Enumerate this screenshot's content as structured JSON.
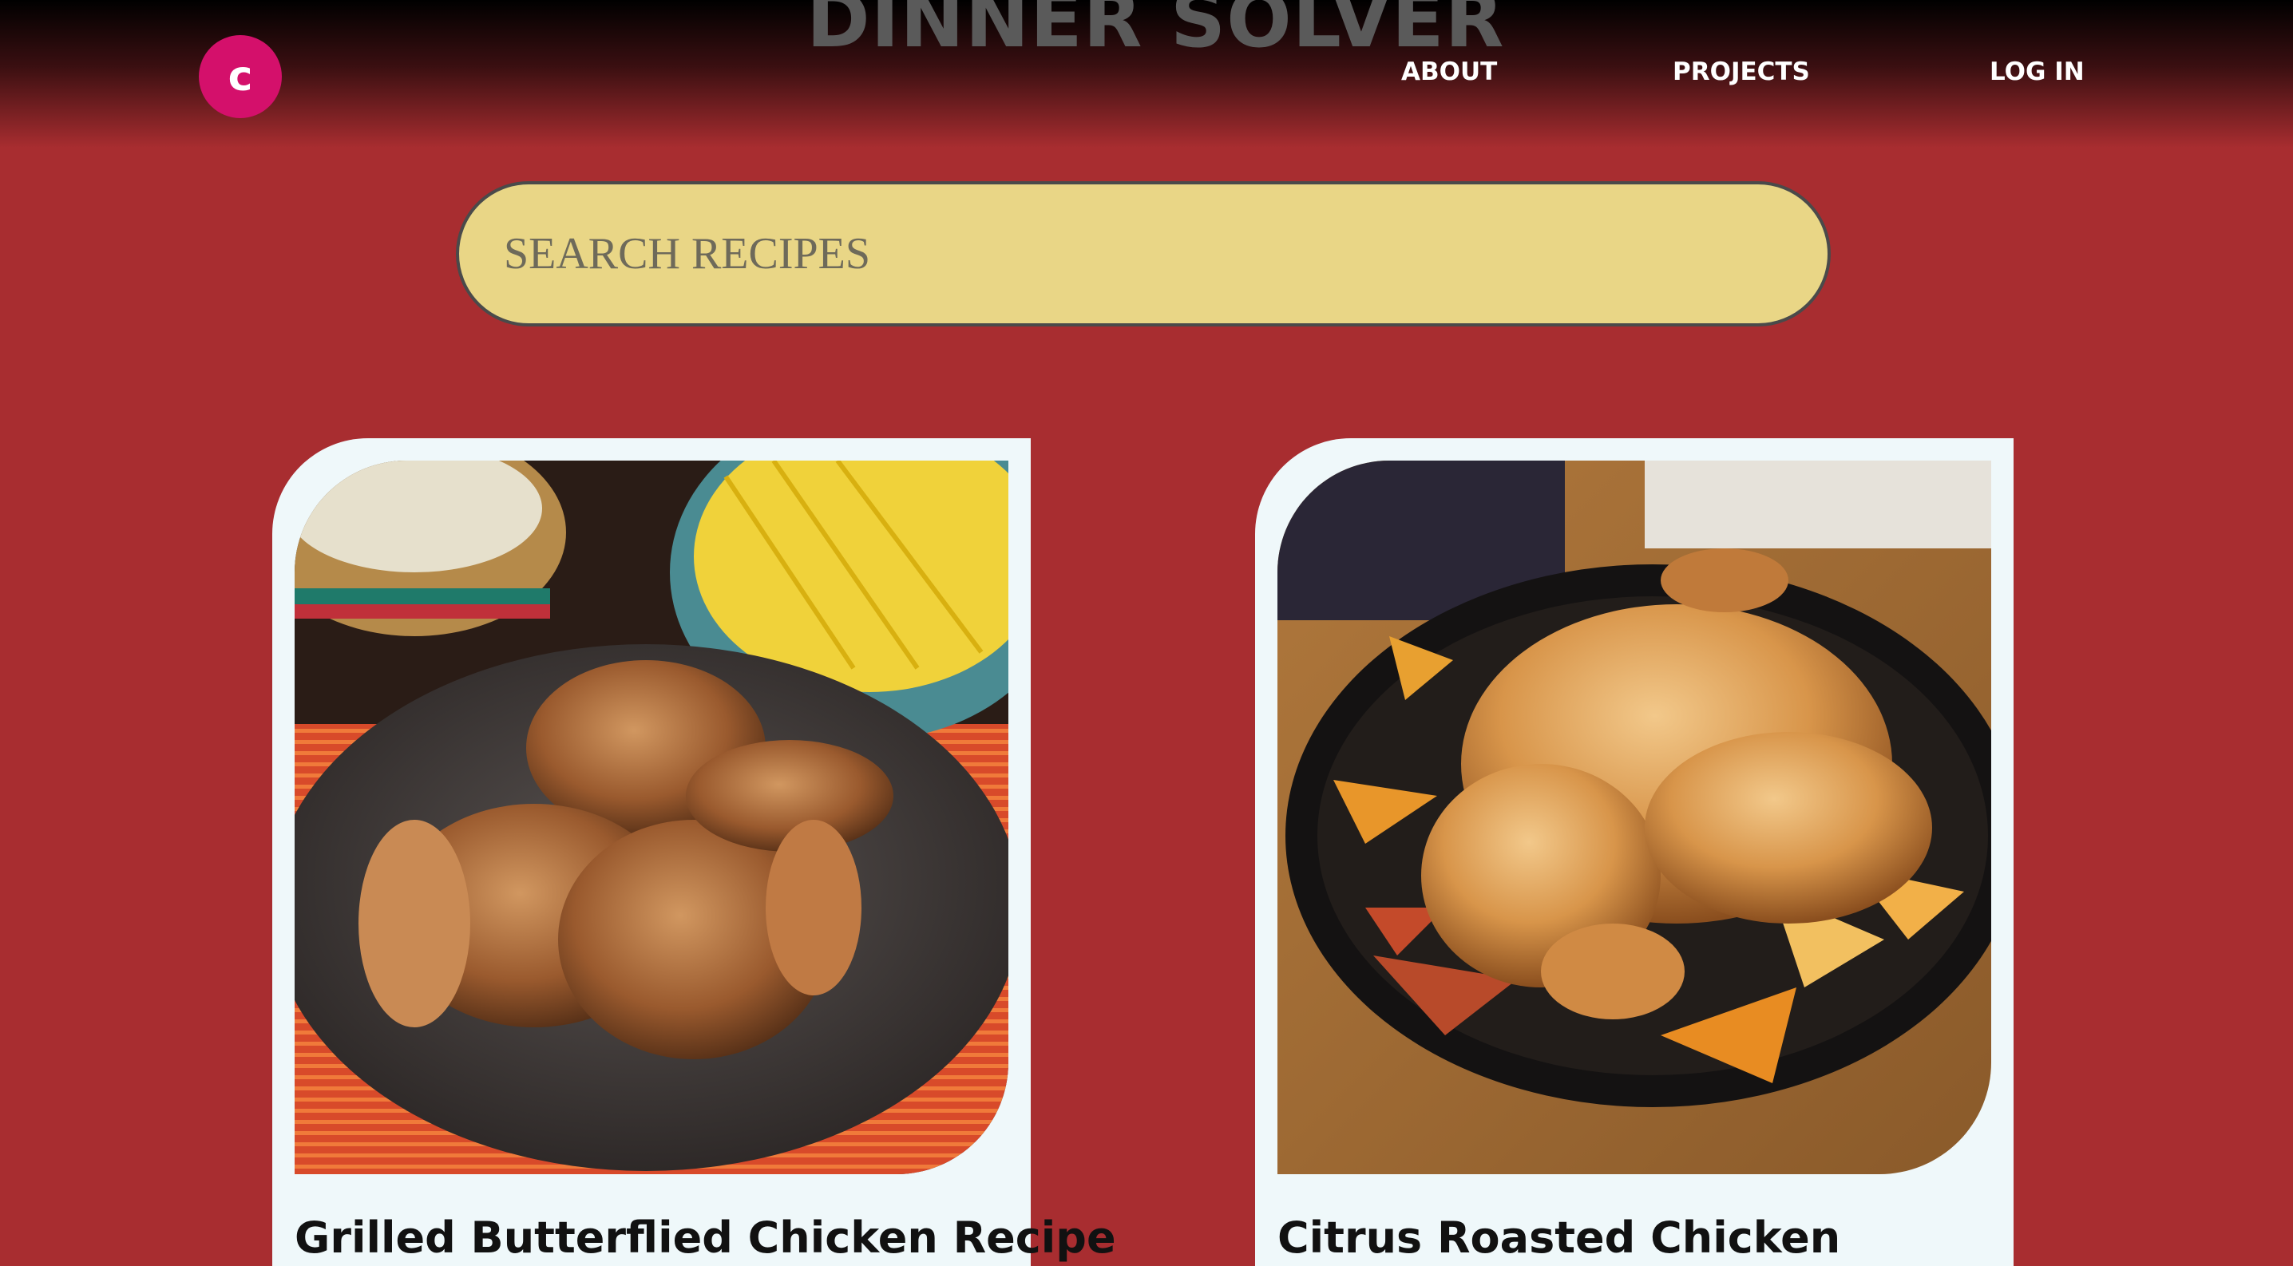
{
  "header": {
    "logo_letter": "c",
    "title": "DINNER SOLVER",
    "nav": {
      "about": "ABOUT",
      "projects": "PROJECTS",
      "login": "LOG IN"
    }
  },
  "search": {
    "placeholder": "SEARCH RECIPES"
  },
  "recipes": [
    {
      "title": "Grilled Butterflied Chicken Recipe"
    },
    {
      "title": "Citrus Roasted Chicken"
    }
  ],
  "colors": {
    "background": "#a82d30",
    "logo": "#d4106b",
    "search_bg": "#e9d686",
    "card_bg": "#eff8fa"
  }
}
